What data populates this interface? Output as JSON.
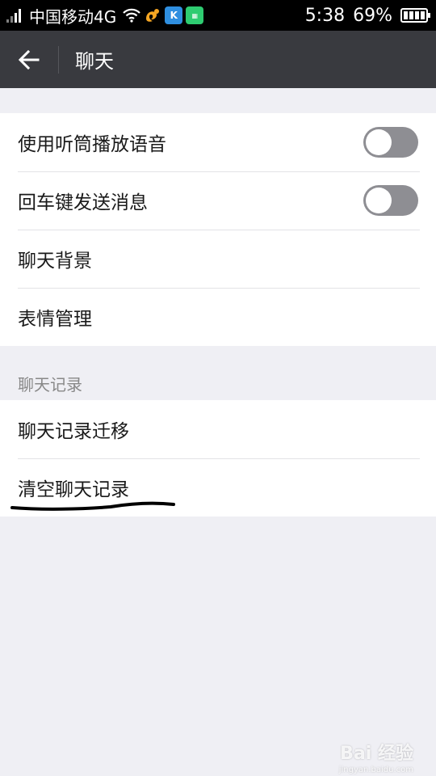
{
  "status_bar": {
    "carrier": "中国移动4G",
    "time": "5:38",
    "battery_percent": "69%",
    "battery_level": 0.69,
    "icons": [
      "signal-icon",
      "wifi-icon",
      "uc-browser-icon",
      "kugou-icon",
      "app-icon",
      "battery-icon"
    ]
  },
  "action_bar": {
    "title": "聊天",
    "back_icon": "arrow-left-icon"
  },
  "settings": {
    "items": [
      {
        "label": "使用听筒播放语音",
        "toggle": false
      },
      {
        "label": "回车键发送消息",
        "toggle": false
      },
      {
        "label": "聊天背景"
      },
      {
        "label": "表情管理"
      }
    ]
  },
  "chat_history": {
    "header": "聊天记录",
    "items": [
      {
        "label": "聊天记录迁移"
      },
      {
        "label": "清空聊天记录"
      }
    ]
  },
  "watermark": {
    "text": "Bai 经验",
    "sub": "jingyan.baidu.com"
  },
  "colors": {
    "action_bar": "#393a3f",
    "background": "#efeff4",
    "toggle_off": "#8e8e93"
  }
}
